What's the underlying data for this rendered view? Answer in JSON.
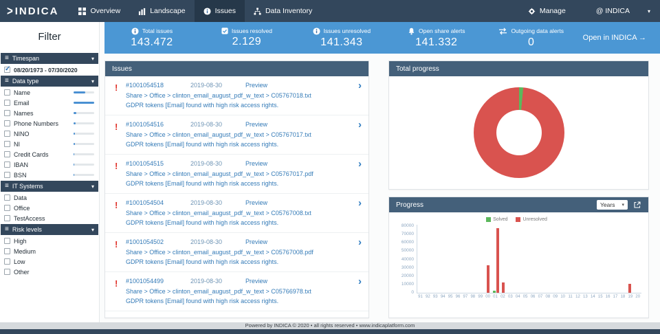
{
  "navbar": {
    "logo": "INDICA",
    "items": [
      {
        "label": "Overview",
        "icon": "grid-icon",
        "active": false
      },
      {
        "label": "Landscape",
        "icon": "barchart-icon",
        "active": false
      },
      {
        "label": "Issues",
        "icon": "info-icon",
        "active": true
      },
      {
        "label": "Data Inventory",
        "icon": "inventory-icon",
        "active": false
      }
    ],
    "manage_label": "Manage",
    "account_label": "@ INDICA"
  },
  "stats_bar": {
    "stats": [
      {
        "label": "Total issues",
        "value": "143.472",
        "icon": "info-icon"
      },
      {
        "label": "Issues resolved",
        "value": "2.129",
        "icon": "check-icon"
      },
      {
        "label": "Issues unresolved",
        "value": "141.343",
        "icon": "info-icon"
      },
      {
        "label": "Open share alerts",
        "value": "141.332",
        "icon": "bell-icon"
      },
      {
        "label": "Outgoing data alerts",
        "value": "0",
        "icon": "arrows-icon"
      }
    ],
    "open_link": "Open in INDICA →"
  },
  "sidebar": {
    "title": "Filter",
    "sections": [
      {
        "label": "Timespan",
        "items": [
          {
            "label": "08/20/1973 - 07/30/2020",
            "checked": true,
            "bold": true
          }
        ]
      },
      {
        "label": "Data type",
        "items": [
          {
            "label": "Name",
            "checked": false,
            "bar": 55
          },
          {
            "label": "Email",
            "checked": false,
            "bar": 100
          },
          {
            "label": "Names",
            "checked": false,
            "bar": 14
          },
          {
            "label": "Phone Numbers",
            "checked": false,
            "bar": 10
          },
          {
            "label": "NINO",
            "checked": false,
            "bar": 7
          },
          {
            "label": "NI",
            "checked": false,
            "bar": 5
          },
          {
            "label": "Credit Cards",
            "checked": false,
            "bar": 4
          },
          {
            "label": "IBAN",
            "checked": false,
            "bar": 3
          },
          {
            "label": "BSN",
            "checked": false,
            "bar": 3
          }
        ]
      },
      {
        "label": "IT Systems",
        "items": [
          {
            "label": "Data",
            "checked": false
          },
          {
            "label": "Office",
            "checked": false
          },
          {
            "label": "TestAccess",
            "checked": false
          }
        ]
      },
      {
        "label": "Risk levels",
        "items": [
          {
            "label": "High",
            "checked": false
          },
          {
            "label": "Medium",
            "checked": false
          },
          {
            "label": "Low",
            "checked": false
          },
          {
            "label": "Other",
            "checked": false
          }
        ]
      }
    ]
  },
  "issues_panel": {
    "title": "Issues",
    "preview_label": "Preview",
    "rows": [
      {
        "id": "#1001054518",
        "date": "2019-08-30",
        "path": "Share > Office > clinton_email_august_pdf_w_text > C05767018.txt",
        "description": "GDPR tokens [Email] found with high risk access rights."
      },
      {
        "id": "#1001054516",
        "date": "2019-08-30",
        "path": "Share > Office > clinton_email_august_pdf_w_text > C05767017.txt",
        "description": "GDPR tokens [Email] found with high risk access rights."
      },
      {
        "id": "#1001054515",
        "date": "2019-08-30",
        "path": "Share > Office > clinton_email_august_pdf_w_text > C05767017.pdf",
        "description": "GDPR tokens [Email] found with high risk access rights."
      },
      {
        "id": "#1001054504",
        "date": "2019-08-30",
        "path": "Share > Office > clinton_email_august_pdf_w_text > C05767008.txt",
        "description": "GDPR tokens [Email] found with high risk access rights."
      },
      {
        "id": "#1001054502",
        "date": "2019-08-30",
        "path": "Share > Office > clinton_email_august_pdf_w_text > C05767008.pdf",
        "description": "GDPR tokens [Email] found with high risk access rights."
      },
      {
        "id": "#1001054499",
        "date": "2019-08-30",
        "path": "Share > Office > clinton_email_august_pdf_w_text > C05766978.txt",
        "description": "GDPR tokens [Email] found with high risk access rights."
      },
      {
        "id": "",
        "date": "",
        "path": "",
        "description": ""
      }
    ]
  },
  "total_progress_panel": {
    "title": "Total progress"
  },
  "progress_panel": {
    "title": "Progress",
    "period_select": "Years",
    "legend": [
      {
        "label": "Solved",
        "color": "#5cb85c"
      },
      {
        "label": "Unresolved",
        "color": "#d9534f"
      }
    ]
  },
  "chart_data": [
    {
      "type": "pie",
      "title": "Total progress",
      "labels": [
        "Solved",
        "Unresolved"
      ],
      "values": [
        2129,
        141343
      ],
      "colors": [
        "#5cb85c",
        "#d9534f"
      ],
      "donut": true
    },
    {
      "type": "bar",
      "title": "Progress",
      "categories": [
        "91",
        "92",
        "93",
        "94",
        "95",
        "96",
        "97",
        "98",
        "99",
        "00",
        "01",
        "02",
        "03",
        "04",
        "05",
        "06",
        "07",
        "08",
        "09",
        "10",
        "11",
        "12",
        "13",
        "14",
        "15",
        "16",
        "17",
        "18",
        "19",
        "20"
      ],
      "series": [
        {
          "name": "Solved",
          "color": "#5cb85c",
          "values": [
            0,
            0,
            0,
            0,
            0,
            0,
            0,
            0,
            0,
            0,
            2000,
            0,
            0,
            0,
            0,
            0,
            0,
            0,
            0,
            0,
            0,
            0,
            0,
            0,
            0,
            0,
            0,
            0,
            0,
            0
          ]
        },
        {
          "name": "Unresolved",
          "color": "#d9534f",
          "values": [
            0,
            0,
            0,
            0,
            0,
            0,
            0,
            0,
            0,
            32000,
            75000,
            12000,
            0,
            0,
            0,
            0,
            0,
            0,
            0,
            0,
            0,
            0,
            0,
            0,
            0,
            0,
            0,
            0,
            10000,
            0
          ]
        }
      ],
      "ylim": [
        0,
        80000
      ],
      "yticks": [
        0,
        10000,
        20000,
        30000,
        40000,
        50000,
        60000,
        70000,
        80000
      ],
      "legend_position": "top",
      "grid": false
    }
  ],
  "footer": {
    "text": "Powered by INDICA © 2020 • all rights reserved • www.indicaplatform.com"
  },
  "colors": {
    "navbar": "#33475c",
    "stats_bar": "#4b97d4",
    "panel_header": "#44607a",
    "alert_red": "#e0342b",
    "link_blue": "#337ab7",
    "solved_green": "#5cb85c",
    "unresolved_red": "#d9534f"
  }
}
